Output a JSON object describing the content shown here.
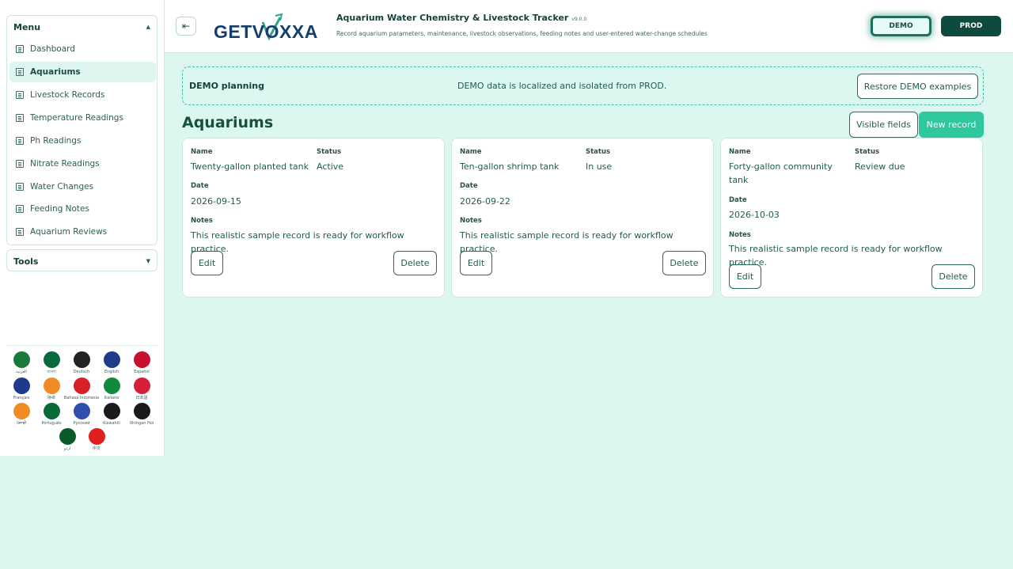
{
  "sidebar": {
    "menu_title": "Menu",
    "tools_title": "Tools",
    "items": [
      {
        "label": "Dashboard"
      },
      {
        "label": "Aquariums"
      },
      {
        "label": "Livestock Records"
      },
      {
        "label": "Temperature Readings"
      },
      {
        "label": "Ph Readings"
      },
      {
        "label": "Nitrate Readings"
      },
      {
        "label": "Water Changes"
      },
      {
        "label": "Feeding Notes"
      },
      {
        "label": "Aquarium Reviews"
      }
    ],
    "active_item": "Aquariums",
    "languages": [
      {
        "label": "العربية",
        "color": "#1a7a3c"
      },
      {
        "label": "বাংলা",
        "color": "#0a6a3f"
      },
      {
        "label": "Deutsch",
        "color": "#222222"
      },
      {
        "label": "English",
        "color": "#1f3b8a"
      },
      {
        "label": "Español",
        "color": "#c8102e"
      },
      {
        "label": "Français",
        "color": "#1e3a8a"
      },
      {
        "label": "हिन्दी",
        "color": "#f08a24"
      },
      {
        "label": "Bahasa Indonesia",
        "color": "#d61f26"
      },
      {
        "label": "Italiano",
        "color": "#128a3e"
      },
      {
        "label": "日本語",
        "color": "#d61f3a"
      },
      {
        "label": "ਪੰਜਾਬੀ",
        "color": "#f08a24"
      },
      {
        "label": "Português",
        "color": "#0a6a35"
      },
      {
        "label": "Русский",
        "color": "#2f4fb0"
      },
      {
        "label": "Kiswahili",
        "color": "#1a1a1a"
      },
      {
        "label": "tlhIngan Hol",
        "color": "#1a1a1a"
      },
      {
        "label": "اردو",
        "color": "#0a5a2a"
      },
      {
        "label": "中文",
        "color": "#e01f1f"
      }
    ]
  },
  "header": {
    "logo_text": "GETVOXXA",
    "title": "Aquarium Water Chemistry & Livestock Tracker",
    "version": "v9.0.0",
    "subtitle": "Record aquarium parameters, maintenance, livestock observations, feeding notes and user-entered water-change schedules",
    "demo_label": "DEMO",
    "prod_label": "PROD"
  },
  "banner": {
    "title": "DEMO planning",
    "message": "DEMO data is localized and isolated from PROD.",
    "restore_label": "Restore DEMO examples"
  },
  "main": {
    "title": "Aquariums",
    "visible_fields_label": "Visible fields",
    "new_record_label": "New record"
  },
  "field_labels": {
    "name": "Name",
    "status": "Status",
    "date": "Date",
    "notes": "Notes",
    "edit": "Edit",
    "delete": "Delete"
  },
  "records": [
    {
      "name": "Twenty-gallon planted tank",
      "status": "Active",
      "date": "2026-09-15",
      "notes": "This realistic sample record is ready for workflow practice."
    },
    {
      "name": "Ten-gallon shrimp tank",
      "status": "In use",
      "date": "2026-09-22",
      "notes": "This realistic sample record is ready for workflow practice."
    },
    {
      "name": "Forty-gallon community tank",
      "status": "Review due",
      "date": "2026-10-03",
      "notes": "This realistic sample record is ready for workflow practice."
    }
  ],
  "colors": {
    "accent": "#2fc79d",
    "dark": "#0e4a3e",
    "background": "#dcf7f0"
  }
}
